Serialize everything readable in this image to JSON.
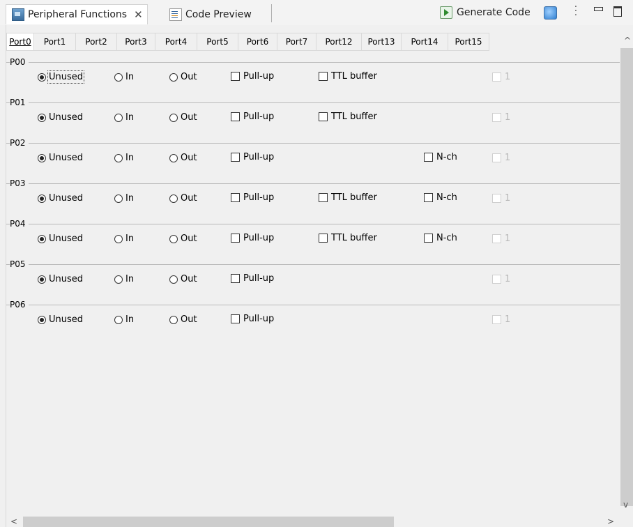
{
  "view_tabs": {
    "peripheral_label": "Peripheral Functions",
    "close_glyph": "✕",
    "code_preview_label": "Code Preview",
    "generate_label": "Generate Code"
  },
  "port_tabs": [
    "Port0",
    "Port1",
    "Port2",
    "Port3",
    "Port4",
    "Port5",
    "Port6",
    "Port7",
    "Port12",
    "Port13",
    "Port14",
    "Port15"
  ],
  "selected_port_tab": "Port0",
  "option_labels": {
    "unused": "Unused",
    "in": "In",
    "out": "Out",
    "pullup": "Pull-up",
    "ttl": "TTL buffer",
    "nch": "N-ch",
    "value": "1"
  },
  "groups": [
    {
      "name": "P00",
      "mode": "Unused",
      "ttl": true,
      "nch": false
    },
    {
      "name": "P01",
      "mode": "Unused",
      "ttl": true,
      "nch": false
    },
    {
      "name": "P02",
      "mode": "Unused",
      "ttl": false,
      "nch": true
    },
    {
      "name": "P03",
      "mode": "Unused",
      "ttl": true,
      "nch": true
    },
    {
      "name": "P04",
      "mode": "Unused",
      "ttl": true,
      "nch": true
    },
    {
      "name": "P05",
      "mode": "Unused",
      "ttl": false,
      "nch": false
    },
    {
      "name": "P06",
      "mode": "Unused",
      "ttl": false,
      "nch": false
    }
  ],
  "scroll": {
    "up": "^",
    "down": "v",
    "left": "<",
    "right": ">"
  }
}
